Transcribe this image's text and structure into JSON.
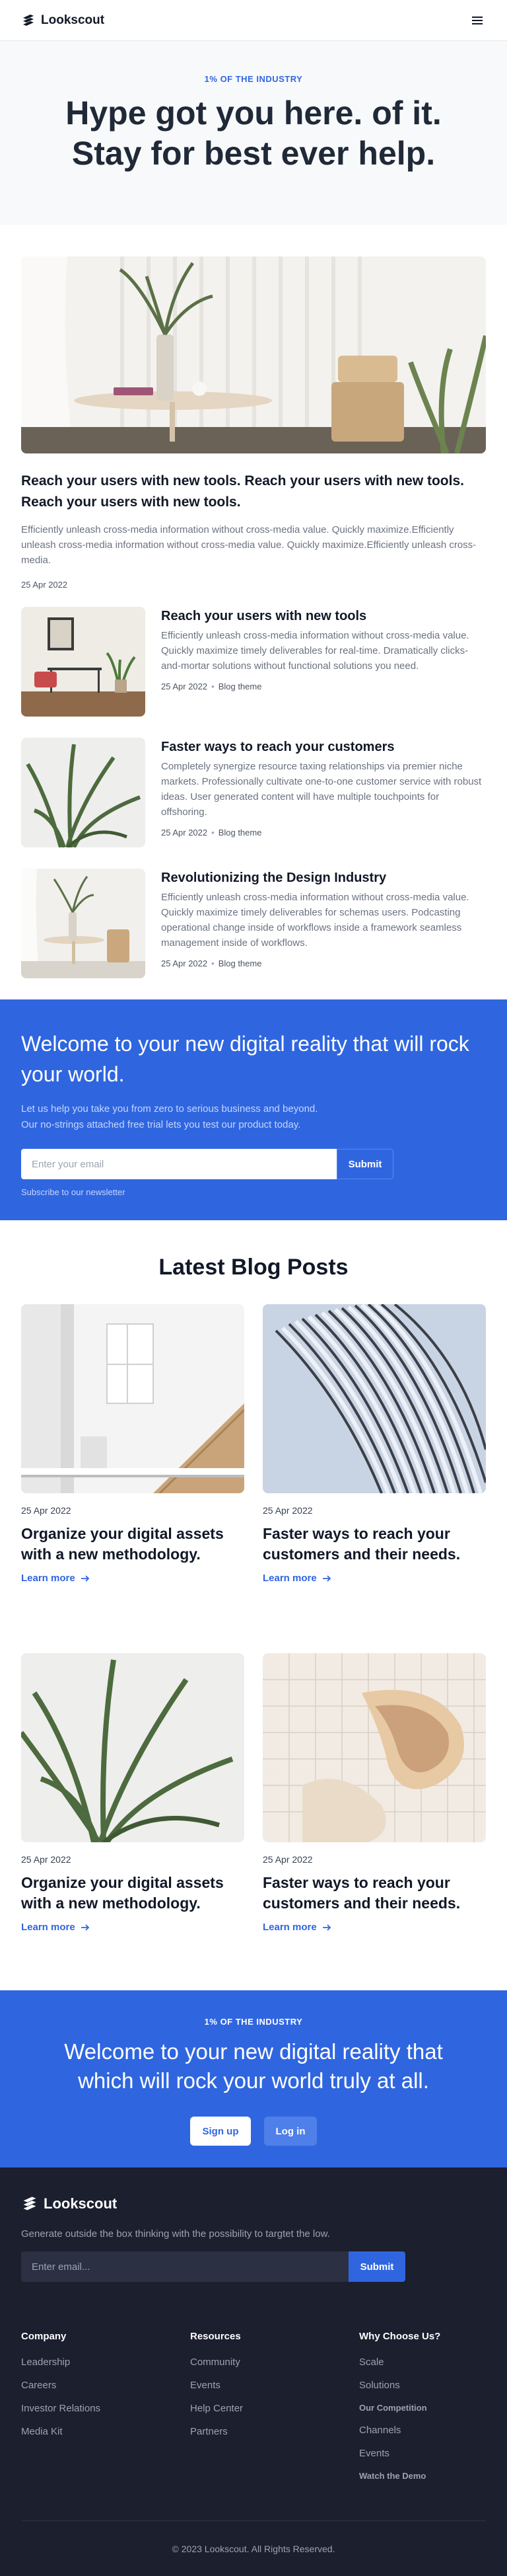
{
  "nav": {
    "brand": "Lookscout",
    "logo_icon": "lookscout-logo-icon",
    "menu_icon": "hamburger-menu-icon"
  },
  "hero": {
    "eyebrow": "1% OF THE INDUSTRY",
    "title": "Hype got you here. of it. Stay for best ever help."
  },
  "featured": {
    "title": "Reach your users with new tools. Reach your users with new tools. Reach your users with new tools.",
    "excerpt": "Efficiently unleash cross-media information without cross-media value. Quickly maximize.Efficiently unleash cross-media information without cross-media value. Quickly maximize.Efficiently unleash cross-media.",
    "date": "25 Apr 2022"
  },
  "posts": [
    {
      "title": "Reach your users with new tools",
      "excerpt": "Efficiently unleash cross-media information without cross-media value. Quickly maximize timely deliverables for real-time. Dramatically clicks-and-mortar solutions without functional solutions you need.",
      "date": "25 Apr 2022",
      "category": "Blog theme"
    },
    {
      "title": "Faster ways to reach your customers",
      "excerpt": "Completely synergize resource taxing relationships via premier niche markets. Professionally cultivate one-to-one customer service with robust ideas. User generated content will have multiple touchpoints for offshoring.",
      "date": "25 Apr 2022",
      "category": "Blog theme"
    },
    {
      "title": "Revolutionizing the Design Industry",
      "excerpt": "Efficiently unleash cross-media information without cross-media value. Quickly maximize timely deliverables for schemas users. Podcasting operational change inside of workflows inside a framework seamless management inside of workflows.",
      "date": "25 Apr 2022",
      "category": "Blog theme"
    }
  ],
  "newsletter": {
    "title": "Welcome to your new digital reality that will rock your world.",
    "text_line1": "Let us help you take you from zero to serious business and beyond.",
    "text_line2": "Our no-strings attached free trial lets you test our product today.",
    "placeholder": "Enter your email",
    "submit": "Submit",
    "subscribe_note": "Subscribe to our newsletter"
  },
  "blog": {
    "heading": "Latest Blog Posts",
    "link_label": "Learn more",
    "cards": [
      {
        "date": "25 Apr 2022",
        "title": "Organize your digital assets with a new methodology."
      },
      {
        "date": "25 Apr 2022",
        "title": "Faster ways to reach your customers and their needs."
      },
      {
        "date": "25 Apr 2022",
        "title": "Organize your digital assets with a new methodology."
      },
      {
        "date": "25 Apr 2022",
        "title": "Faster ways to reach your customers and their needs."
      }
    ]
  },
  "cta": {
    "eyebrow": "1% OF THE INDUSTRY",
    "title": "Welcome to your new digital reality that which will rock your world truly at all.",
    "signup": "Sign up",
    "login": "Log in"
  },
  "footer": {
    "brand": "Lookscout",
    "tagline": "Generate outside the box thinking with the possibility to targtet the low.",
    "placeholder": "Enter email...",
    "submit": "Submit",
    "columns": [
      {
        "heading": "Company",
        "links": [
          "Leadership",
          "Careers",
          "Investor Relations",
          "Media Kit"
        ]
      },
      {
        "heading": "Resources",
        "links": [
          "Community",
          "Events",
          "Help Center",
          "Partners"
        ]
      },
      {
        "heading": "Why Choose Us?",
        "links": [
          "Scale",
          "Solutions",
          "Our Competition",
          "Channels",
          "Events",
          "Watch the Demo"
        ]
      }
    ],
    "copyright": "© 2023 Lookscout. All Rights Reserved."
  },
  "colors": {
    "accent": "#2f66e0",
    "footer_bg": "#1b1f2e",
    "hero_bg": "#f8f9fb"
  }
}
